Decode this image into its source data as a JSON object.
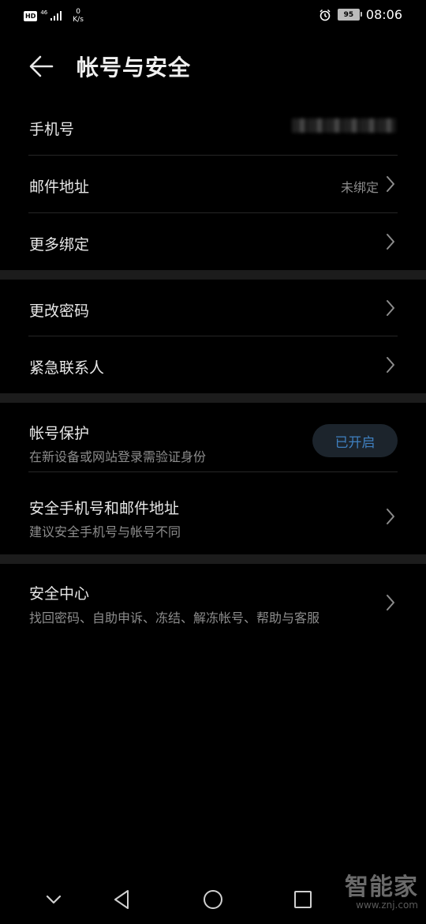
{
  "status_bar": {
    "hd": "HD",
    "network": "46",
    "speed_value": "0",
    "speed_unit": "K/s",
    "battery": "95",
    "time": "08:06"
  },
  "header": {
    "title": "帐号与安全"
  },
  "section1": {
    "phone_label": "手机号",
    "email_label": "邮件地址",
    "email_value": "未绑定",
    "more_binding_label": "更多绑定"
  },
  "section2": {
    "change_password_label": "更改密码",
    "emergency_contact_label": "紧急联系人"
  },
  "section3": {
    "account_protection_title": "帐号保护",
    "account_protection_sub": "在新设备或网站登录需验证身份",
    "account_protection_status": "已开启",
    "secure_phone_email_title": "安全手机号和邮件地址",
    "secure_phone_email_sub": "建议安全手机号与帐号不同"
  },
  "section4": {
    "security_center_title": "安全中心",
    "security_center_sub": "找回密码、自助申诉、冻结、解冻帐号、帮助与客服"
  },
  "watermark": {
    "main": "智能家",
    "sub": "www.znj.com"
  }
}
